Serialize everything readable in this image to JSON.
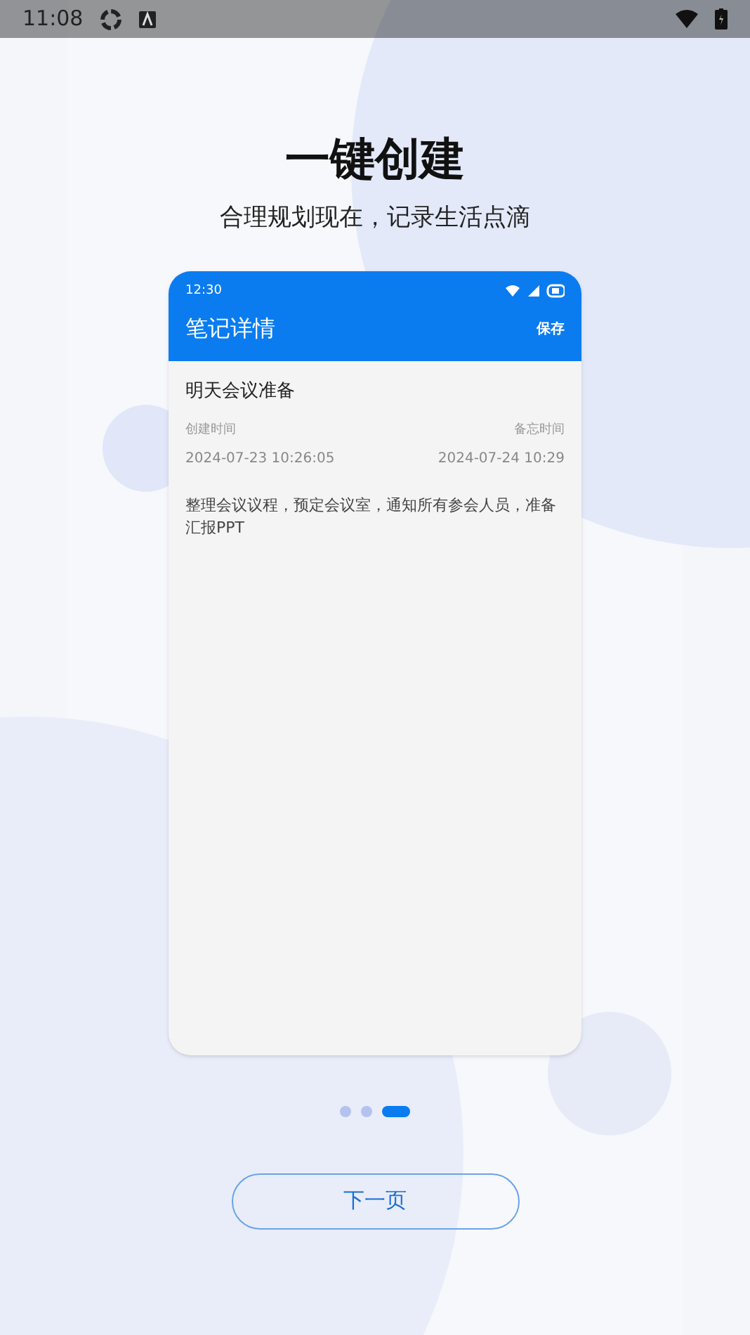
{
  "status_bar": {
    "time": "11:08"
  },
  "title": "一键创建",
  "subtitle": "合理规划现在，记录生活点滴",
  "preview": {
    "status_time": "12:30",
    "header_title": "笔记详情",
    "save_label": "保存",
    "note_title": "明天会议准备",
    "fields": [
      {
        "label": "创建时间",
        "value": "2024-07-23 10:26:05"
      },
      {
        "label": "备忘时间",
        "value": "2024-07-24 10:29"
      }
    ],
    "body": "整理会议议程，预定会议室，通知所有参会人员，准备汇报PPT"
  },
  "pages": [
    {
      "selected": false
    },
    {
      "selected": false
    },
    {
      "selected": true
    }
  ],
  "next_button": "下一页"
}
